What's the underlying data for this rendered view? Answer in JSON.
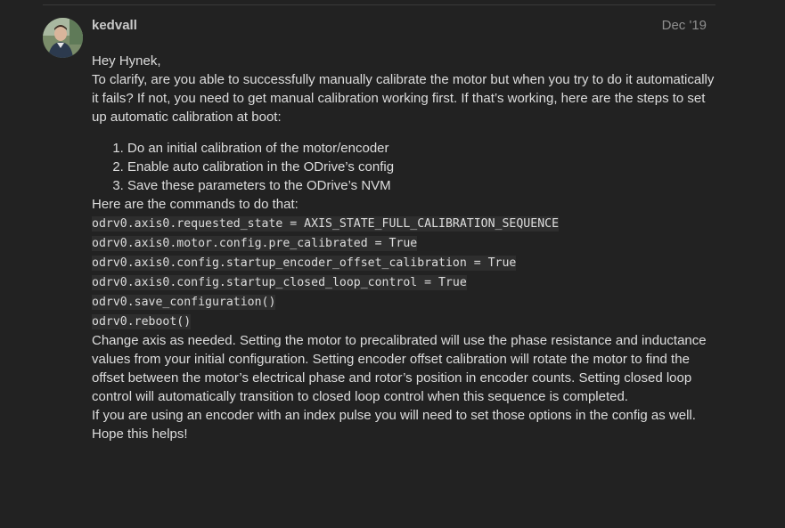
{
  "post": {
    "username": "kedvall",
    "date": "Dec '19",
    "greeting": "Hey Hynek,",
    "intro": "To clarify, are you able to successfully manually calibrate the motor but when you try to do it automatically it fails? If not, you need to get manual calibration working first. If that’s working, here are the steps to set up automatic calibration at boot:",
    "steps": [
      "Do an initial calibration of the motor/encoder",
      "Enable auto calibration in the ODrive’s config",
      "Save these parameters to the ODrive’s NVM"
    ],
    "commands_intro": "Here are the commands to do that:",
    "code_lines": [
      "odrv0.axis0.requested_state = AXIS_STATE_FULL_CALIBRATION_SEQUENCE",
      "odrv0.axis0.motor.config.pre_calibrated = True",
      "odrv0.axis0.config.startup_encoder_offset_calibration = True",
      "odrv0.axis0.config.startup_closed_loop_control = True",
      "odrv0.save_configuration()",
      "odrv0.reboot()"
    ],
    "explanation": "Change axis as needed. Setting the motor to precalibrated will use the phase resistance and inductance values from your initial configuration. Setting encoder offset calibration will rotate the motor to find the offset between the motor’s electrical phase and rotor’s position in encoder counts. Setting closed loop control will automatically transition to closed loop control when this sequence is completed.",
    "index_note": "If you are using an encoder with an index pulse you will need to set those options in the config as well.",
    "closing": "Hope this helps!"
  },
  "colors": {
    "background": "#222222",
    "text": "#dddddd",
    "username": "#c9c9c9",
    "date": "#8f8f8f",
    "code_background": "#2e2e2e"
  },
  "icons": {
    "avatar": "user-avatar-photo"
  }
}
